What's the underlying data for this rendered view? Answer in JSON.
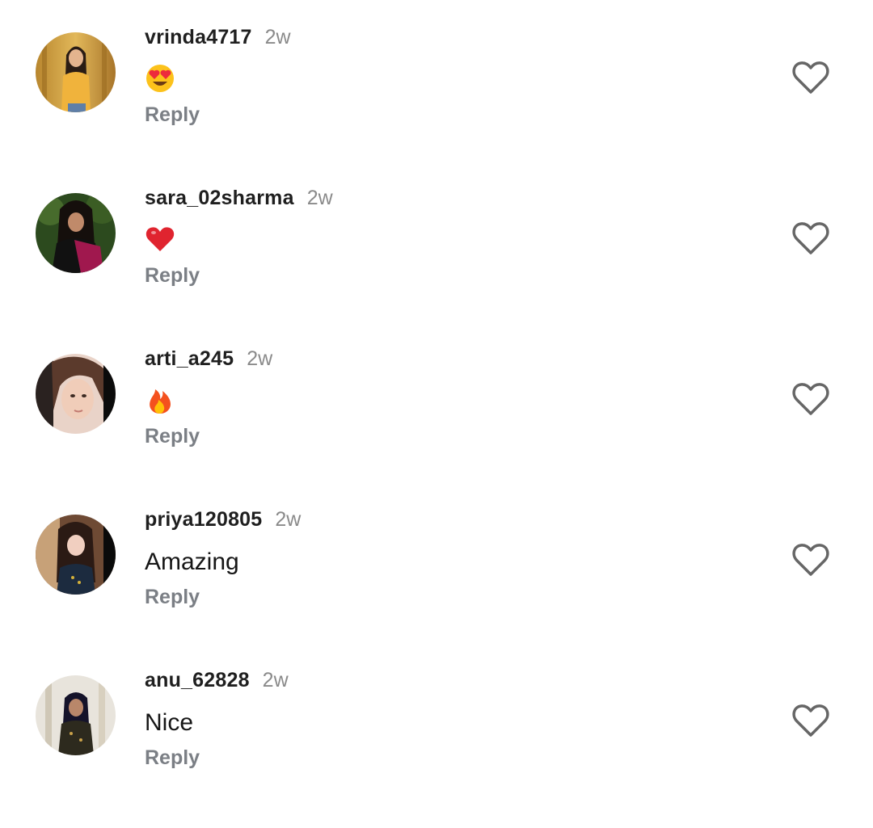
{
  "comments": [
    {
      "username": "vrinda4717",
      "time": "2w",
      "text": "",
      "emoji": "heart-eyes-emoji",
      "reply": "Reply"
    },
    {
      "username": "sara_02sharma",
      "time": "2w",
      "text": "",
      "emoji": "red-heart-emoji",
      "reply": "Reply"
    },
    {
      "username": "arti_a245",
      "time": "2w",
      "text": "",
      "emoji": "fire-emoji",
      "reply": "Reply"
    },
    {
      "username": "priya120805",
      "time": "2w",
      "text": "Amazing",
      "emoji": "",
      "reply": "Reply"
    },
    {
      "username": "anu_62828",
      "time": "2w",
      "text": "Nice",
      "emoji": "",
      "reply": "Reply"
    }
  ],
  "icons": {
    "like": "heart-outline-icon"
  },
  "colors": {
    "username": "#1f1f1f",
    "timestamp": "#8a8a8a",
    "reply": "#7b7f85",
    "like_icon": "#666666"
  }
}
